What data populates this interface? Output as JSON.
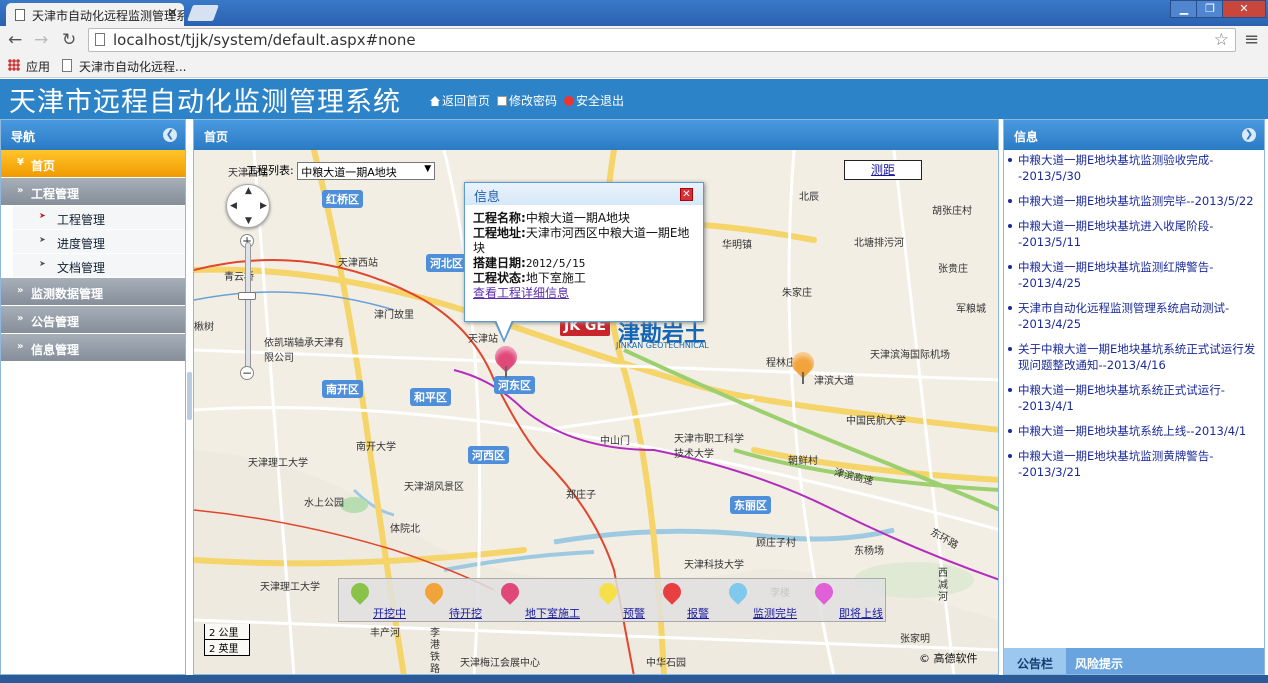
{
  "browser": {
    "tab_title": "天津市自动化远程监测管理系统",
    "address": "localhost/tjjk/system/default.aspx#none",
    "bookmark_apps": "应用",
    "bookmark_page": "天津市自动化远程..."
  },
  "header": {
    "title": "天津市远程自动化监测管理系统",
    "links": [
      "返回首页",
      "修改密码",
      "安全退出"
    ]
  },
  "nav": {
    "title": "导航",
    "home": "首页",
    "groups": [
      {
        "label": "工程管理",
        "children": [
          "工程管理",
          "进度管理",
          "文档管理"
        ]
      },
      {
        "label": "监测数据管理"
      },
      {
        "label": "公告管理"
      },
      {
        "label": "信息管理"
      }
    ]
  },
  "main": {
    "title": "首页",
    "project_list_label": "工程列表:",
    "project_selected": "中粮大道一期A地块",
    "measure_label": "测距",
    "popup": {
      "title": "信息",
      "name_label": "工程名称:",
      "name_value": "中粮大道一期A地块",
      "address_label": "工程地址:",
      "address_value": "天津市河西区中粮大道一期E地块",
      "date_label": "搭建日期:",
      "date_value": "2012/5/15",
      "status_label": "工程状态:",
      "status_value": "地下室施工",
      "detail_link": "查看工程详细信息"
    },
    "watermark": {
      "logo": "JK GE",
      "name": "津勘岩土",
      "en": "JINKAN GEOTECHNICAL"
    },
    "legend": [
      {
        "label": "开挖中",
        "color": "#8bc34a"
      },
      {
        "label": "待开挖",
        "color": "#f2a33a"
      },
      {
        "label": "地下室施工",
        "color": "#e0487a"
      },
      {
        "label": "预警",
        "color": "#f5e04a"
      },
      {
        "label": "报警",
        "color": "#e84040"
      },
      {
        "label": "监测完毕",
        "color": "#7fc8ee"
      },
      {
        "label": "即将上线",
        "color": "#e060d8"
      }
    ],
    "scale": [
      "2 公里",
      "2 英里"
    ],
    "copyright": "© 高德软件",
    "map_labels": {
      "districts": [
        "红桥区",
        "河北区",
        "南开区",
        "和平区",
        "河东区",
        "河西区",
        "东丽区"
      ],
      "places": [
        "天津西站",
        "天津站",
        "北辰",
        "华明镇",
        "胡张庄村",
        "北塘排污河",
        "程林庄村",
        "朱家庄",
        "天津滨海国际机场",
        "中国民航大学",
        "天津市职工科学技术大学",
        "中山门",
        "朝鲜村",
        "南开大学",
        "天津理工大学",
        "天津湖风景区",
        "水上公园",
        "体院北",
        "郑庄子",
        "顾庄子村",
        "天津科技大学",
        "东杨场",
        "天津理工大学",
        "津门故里",
        "依凯瑞轴承天津有限公司",
        "天津梅江会展中心",
        "中华石园",
        "张家明",
        "李楼",
        "青云桥",
        "楸树",
        "丰产河",
        "李港铁路",
        "津滨高速",
        "津滨大道",
        "东环路",
        "张贵庄",
        "军粮城",
        "西减河"
      ]
    }
  },
  "info": {
    "title": "信息",
    "items": [
      "中粮大道一期E地块基坑监测验收完成--2013/5/30",
      "中粮大道一期E地块基坑监测完毕--2013/5/22",
      "中粮大道一期E地块基坑进入收尾阶段--2013/5/11",
      "中粮大道一期E地块基坑监测红牌警告--2013/4/25",
      "天津市自动化远程监测管理系统启动测试--2013/4/25",
      "关于中粮大道一期E地块基坑系统正式试运行发现问题整改通知--2013/4/16",
      "中粮大道一期E地块基坑系统正式试运行--2013/4/1",
      "中粮大道一期E地块基坑系统上线--2013/4/1",
      "中粮大道一期E地块基坑监测黄牌警告--2013/3/21"
    ],
    "tabs": [
      "公告栏",
      "风险提示"
    ]
  },
  "colors": {
    "header": "#2d83c8",
    "home_active": "#f7a800",
    "nav_group": "#8e97a2",
    "link": "#1a2a9a"
  }
}
